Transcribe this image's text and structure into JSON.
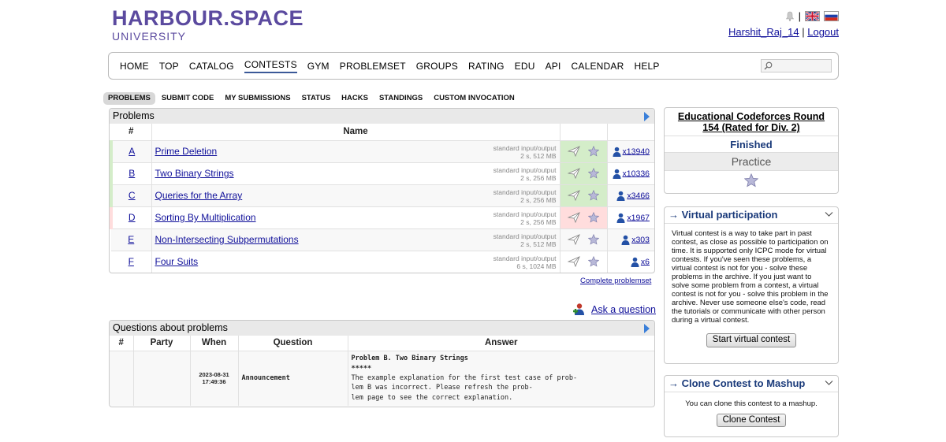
{
  "header": {
    "logo_main": "HARBOUR.SPACE",
    "logo_sub": "UNIVERSITY",
    "separator": "|",
    "username": "Harshit_Raj_14",
    "logout": "Logout",
    "user_sep": "|"
  },
  "nav": {
    "items": [
      "HOME",
      "TOP",
      "CATALOG",
      "CONTESTS",
      "GYM",
      "PROBLEMSET",
      "GROUPS",
      "RATING",
      "EDU",
      "API",
      "CALENDAR",
      "HELP"
    ],
    "active": "CONTESTS",
    "search_placeholder": ""
  },
  "submenu": {
    "items": [
      "PROBLEMS",
      "SUBMIT CODE",
      "MY SUBMISSIONS",
      "STATUS",
      "HACKS",
      "STANDINGS",
      "CUSTOM INVOCATION"
    ],
    "active": "PROBLEMS"
  },
  "problems": {
    "title": "Problems",
    "col_idx": "#",
    "col_name": "Name",
    "rows": [
      {
        "idx": "A",
        "name": "Prime Deletion",
        "io": "standard input/output",
        "limits": "2 s, 512 MB",
        "solved": "x13940",
        "status": "ok"
      },
      {
        "idx": "B",
        "name": "Two Binary Strings",
        "io": "standard input/output",
        "limits": "2 s, 256 MB",
        "solved": "x10336",
        "status": "ok"
      },
      {
        "idx": "C",
        "name": "Queries for the Array",
        "io": "standard input/output",
        "limits": "2 s, 256 MB",
        "solved": "x3466",
        "status": "ok"
      },
      {
        "idx": "D",
        "name": "Sorting By Multiplication",
        "io": "standard input/output",
        "limits": "2 s, 256 MB",
        "solved": "x1967",
        "status": "bad"
      },
      {
        "idx": "E",
        "name": "Non-Intersecting Subpermutations",
        "io": "standard input/output",
        "limits": "2 s, 512 MB",
        "solved": "x303",
        "status": "none"
      },
      {
        "idx": "F",
        "name": "Four Suits",
        "io": "standard input/output",
        "limits": "6 s, 1024 MB",
        "solved": "x6",
        "status": "none"
      }
    ],
    "complete_link": "Complete problemset"
  },
  "ask_question": "Ask a question",
  "questions": {
    "title": "Questions about problems",
    "columns": [
      "#",
      "Party",
      "When",
      "Question",
      "Answer"
    ],
    "rows": [
      {
        "num": "",
        "party": "",
        "when_date": "2023-08-31",
        "when_time": "17:49:36",
        "question": "Announcement",
        "answer_title": "Problem B. Two Binary Strings",
        "answer_stars": "*****",
        "answer_line1": "The example explanation for the first test case of prob-",
        "answer_line2": "lem B was incorrect. Please refresh the prob-",
        "answer_line3": "lem page to see the correct explanation."
      }
    ]
  },
  "contest": {
    "name": "Educational Codeforces Round 154 (Rated for Div. 2)",
    "status": "Finished",
    "phase": "Practice"
  },
  "virtual": {
    "title": "→ Virtual participation",
    "text": "Virtual contest is a way to take part in past contest, as close as possible to participation on time. It is supported only ICPC mode for virtual contests. If you've seen these problems, a virtual contest is not for you - solve these problems in the archive. If you just want to solve some problem from a contest, a virtual contest is not for you - solve this problem in the archive. Never use someone else's code, read the tutorials or communicate with other person during a virtual contest.",
    "button": "Start virtual contest"
  },
  "clone": {
    "title": "→ Clone Contest to Mashup",
    "text": "You can clone this contest to a mashup.",
    "button": "Clone Contest"
  },
  "colors": {
    "brand": "#5b4a9f",
    "link": "#10109a",
    "accepted": "#d4edc9",
    "rejected": "#ffdddd",
    "sidebar_title": "#1a3a7a"
  }
}
